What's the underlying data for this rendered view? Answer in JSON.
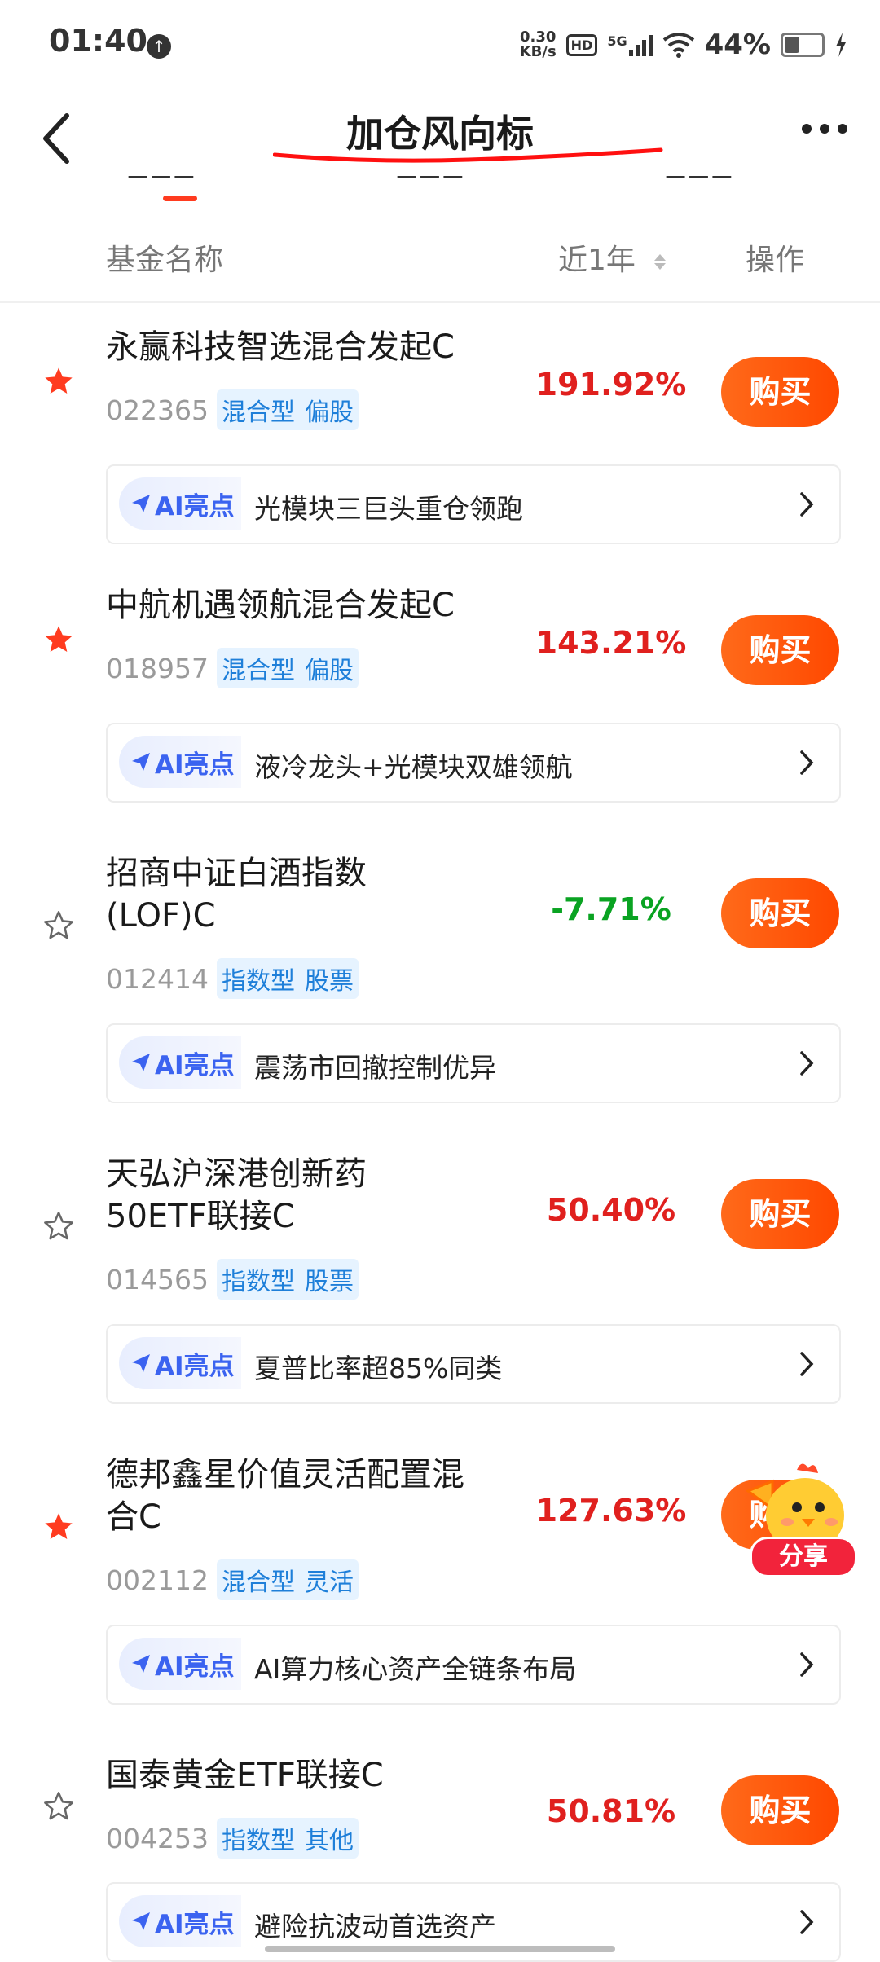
{
  "status_bar": {
    "time": "01:40",
    "speed_value": "0.30",
    "speed_unit": "KB/s",
    "hd": "HD",
    "network": "5G",
    "battery": "44%"
  },
  "nav": {
    "title": "加仓风向标",
    "back_icon": "chevron-left-icon",
    "more_icon": "more-dots-icon"
  },
  "table_header": {
    "name": "基金名称",
    "return_period": "近1年",
    "action": "操作"
  },
  "ai_label": "AI亮点",
  "buy_label": "购买",
  "colors": {
    "accent": "#ff5a0f",
    "up": "#e0201e",
    "down": "#0aa322",
    "tag_text": "#1e7fd9",
    "star_filled": "#ff3b1f"
  },
  "funds": [
    {
      "name": "永赢科技智选混合发起C",
      "code": "022365",
      "tag1": "混合型",
      "tag2": "偏股",
      "return": "191.92%",
      "trend": "up",
      "starred": true,
      "ai_highlight": "光模块三巨头重仓领跑"
    },
    {
      "name": "中航机遇领航混合发起C",
      "code": "018957",
      "tag1": "混合型",
      "tag2": "偏股",
      "return": "143.21%",
      "trend": "up",
      "starred": true,
      "ai_highlight": "液冷龙头+光模块双雄领航"
    },
    {
      "name": "招商中证白酒指数(LOF)C",
      "code": "012414",
      "tag1": "指数型",
      "tag2": "股票",
      "return": "-7.71%",
      "trend": "down",
      "starred": false,
      "ai_highlight": "震荡市回撤控制优异"
    },
    {
      "name": "天弘沪深港创新药50ETF联接C",
      "code": "014565",
      "tag1": "指数型",
      "tag2": "股票",
      "return": "50.40%",
      "trend": "up",
      "starred": false,
      "ai_highlight": "夏普比率超85%同类"
    },
    {
      "name": "德邦鑫星价值灵活配置混合C",
      "code": "002112",
      "tag1": "混合型",
      "tag2": "灵活",
      "return": "127.63%",
      "trend": "up",
      "starred": true,
      "ai_highlight": "AI算力核心资产全链条布局"
    },
    {
      "name": "国泰黄金ETF联接C",
      "code": "004253",
      "tag1": "指数型",
      "tag2": "其他",
      "return": "50.81%",
      "trend": "up",
      "starred": false,
      "ai_highlight": "避险抗波动首选资产"
    }
  ],
  "share": {
    "label": "分享"
  }
}
